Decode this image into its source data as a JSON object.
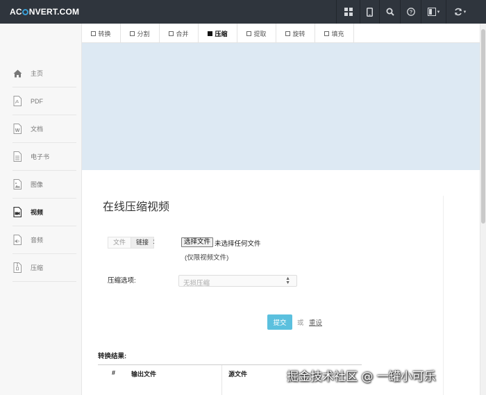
{
  "brand": {
    "logo_prefix": "AC",
    "logo_suffix": "NVERT.COM"
  },
  "topnav": {
    "icons": [
      "apps-grid-icon",
      "mobile-icon",
      "search-icon",
      "help-icon",
      "language-icon",
      "refresh-icon"
    ]
  },
  "sidebar": {
    "items": [
      {
        "label": "主页",
        "icon": "home-icon"
      },
      {
        "label": "PDF",
        "icon": "pdf-icon"
      },
      {
        "label": "文档",
        "icon": "word-icon"
      },
      {
        "label": "电子书",
        "icon": "ebook-icon"
      },
      {
        "label": "图像",
        "icon": "image-icon"
      },
      {
        "label": "视频",
        "icon": "video-icon",
        "active": true
      },
      {
        "label": "音频",
        "icon": "audio-icon"
      },
      {
        "label": "压缩",
        "icon": "archive-icon"
      }
    ]
  },
  "tabs": [
    {
      "label": "转换"
    },
    {
      "label": "分割"
    },
    {
      "label": "合并"
    },
    {
      "label": "压缩",
      "active": true
    },
    {
      "label": "提取"
    },
    {
      "label": "旋转"
    },
    {
      "label": "填充"
    }
  ],
  "main": {
    "title": "在线压缩视频",
    "source_toggle": {
      "file": "文件",
      "link": "链接"
    },
    "colon": ":",
    "choose_file_button": "选择文件",
    "no_file_text": "未选择任何文件",
    "only_video_hint": "(仅限视频文件)",
    "option_label": "压缩选项:",
    "option_select_value": "无损压缩",
    "submit_button": "提交",
    "or_text": "或",
    "reset_link": "重设",
    "results_label": "转换结果:",
    "table_headers": [
      "#",
      "输出文件",
      "源文件"
    ]
  },
  "watermark": "掘金技术社区 @ 一罐小可乐",
  "colors": {
    "topbar": "#2f353d",
    "submit": "#5bc0de",
    "banner": "#dde9f3"
  }
}
